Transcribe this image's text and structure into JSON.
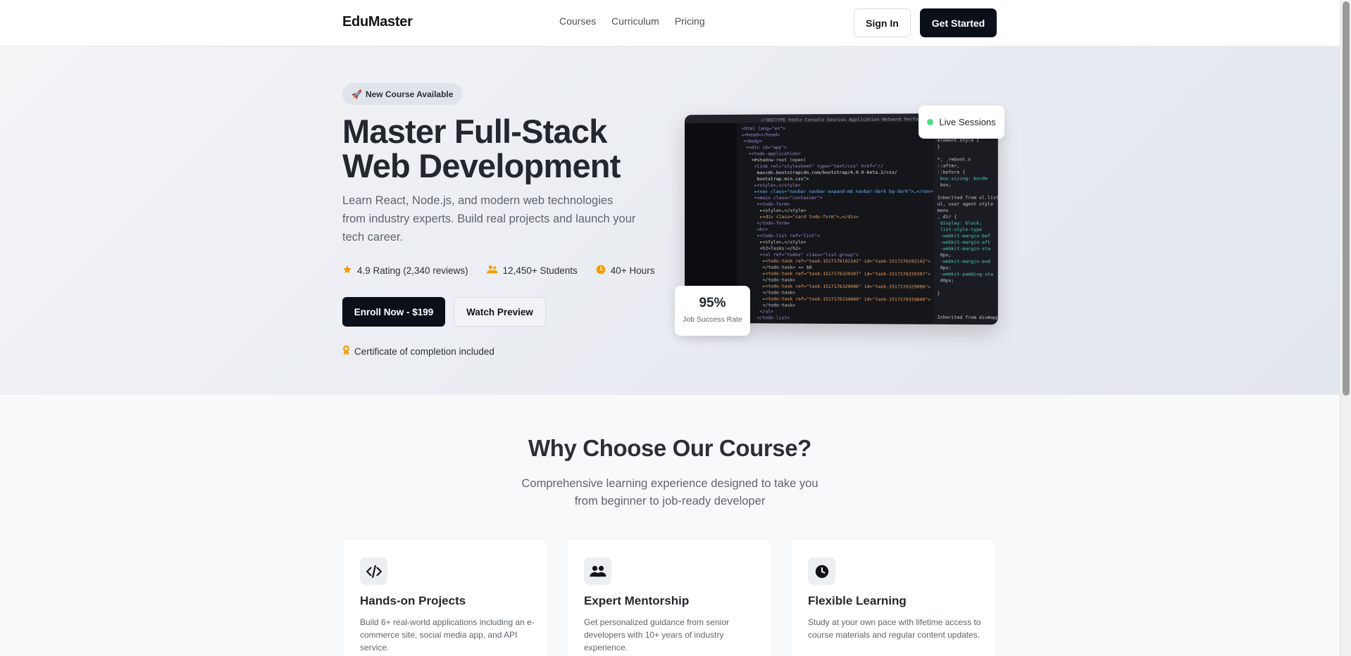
{
  "nav": {
    "brand": "EduMaster",
    "links": [
      "Courses",
      "Curriculum",
      "Pricing"
    ],
    "signin": "Sign In",
    "get_started": "Get Started"
  },
  "hero": {
    "badge_icon": "🚀",
    "badge": "New Course Available",
    "title_line1": "Master Full-Stack",
    "title_line2": "Web Development",
    "subtitle": "Learn React, Node.js, and modern web technologies from industry experts. Build real projects and launch your tech career.",
    "stats": [
      {
        "icon": "star-icon",
        "text": "4.9 Rating (2,340 reviews)"
      },
      {
        "icon": "users-icon",
        "text": "12,450+ Students"
      },
      {
        "icon": "clock-icon",
        "text": "40+ Hours"
      }
    ],
    "enroll": "Enroll Now - $199",
    "preview": "Watch Preview",
    "certificate": "Certificate of completion included",
    "live": "Live Sessions",
    "success_value": "95%",
    "success_label": "Job Success Rate"
  },
  "features": {
    "title": "Why Choose Our Course?",
    "subtitle": "Comprehensive learning experience designed to take you from beginner to job-ready developer",
    "cards": [
      {
        "icon": "code-icon",
        "title": "Hands-on Projects",
        "desc": "Build 6+ real-world applications including an e-commerce site, social media app, and API service."
      },
      {
        "icon": "users-icon",
        "title": "Expert Mentorship",
        "desc": "Get personalized guidance from senior developers with 10+ years of industry experience."
      },
      {
        "icon": "clock-icon",
        "title": "Flexible Learning",
        "desc": "Study at your own pace with lifetime access to course materials and regular content updates."
      }
    ]
  },
  "colors": {
    "primary": "#0b0f19",
    "accent": "#f59e0b",
    "live_dot": "#4ade80"
  }
}
